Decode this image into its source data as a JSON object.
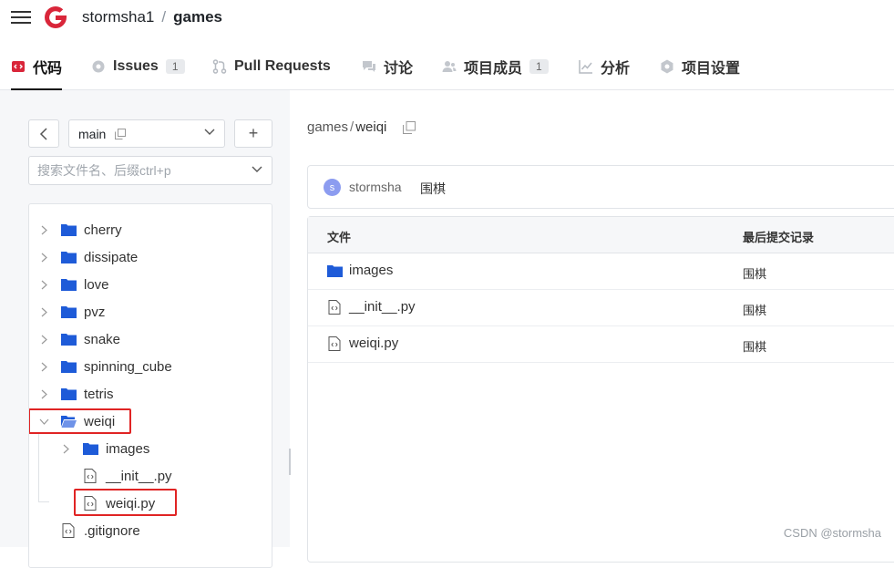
{
  "header": {
    "owner": "stormsha1",
    "separator": "/",
    "repo": "games"
  },
  "tabs": [
    {
      "label": "代码",
      "icon": "code-icon",
      "active": true
    },
    {
      "label": "Issues",
      "icon": "issue-icon",
      "count": "1"
    },
    {
      "label": "Pull Requests",
      "icon": "pull-request-icon"
    },
    {
      "label": "讨论",
      "icon": "discussion-icon"
    },
    {
      "label": "项目成员",
      "icon": "members-icon",
      "count": "1"
    },
    {
      "label": "分析",
      "icon": "analytics-icon"
    },
    {
      "label": "项目设置",
      "icon": "settings-icon"
    }
  ],
  "sidebar": {
    "branch": "main",
    "add_label": "+",
    "search_placeholder": "搜索文件名、后缀ctrl+p",
    "tree": [
      {
        "label": "cherry",
        "type": "folder",
        "expanded": false
      },
      {
        "label": "dissipate",
        "type": "folder",
        "expanded": false
      },
      {
        "label": "love",
        "type": "folder",
        "expanded": false
      },
      {
        "label": "pvz",
        "type": "folder",
        "expanded": false
      },
      {
        "label": "snake",
        "type": "folder",
        "expanded": false
      },
      {
        "label": "spinning_cube",
        "type": "folder",
        "expanded": false
      },
      {
        "label": "tetris",
        "type": "folder",
        "expanded": false
      },
      {
        "label": "weiqi",
        "type": "folder",
        "expanded": true
      },
      {
        "label": "images",
        "type": "folder",
        "expanded": false
      },
      {
        "label": "__init__.py",
        "type": "file"
      },
      {
        "label": "weiqi.py",
        "type": "file"
      },
      {
        "label": ".gitignore",
        "type": "file"
      }
    ]
  },
  "main": {
    "breadcrumb": [
      "games",
      "weiqi"
    ],
    "breadcrumb_sep": "/",
    "commit": {
      "avatar_letter": "s",
      "author": "stormsha",
      "message": "围棋"
    },
    "table": {
      "col_file": "文件",
      "col_commit": "最后提交记录",
      "rows": [
        {
          "name": "images",
          "type": "folder",
          "commit": "围棋"
        },
        {
          "name": "__init__.py",
          "type": "file",
          "commit": "围棋"
        },
        {
          "name": "weiqi.py",
          "type": "file",
          "commit": "围棋"
        }
      ]
    }
  },
  "watermark": "CSDN @stormsha",
  "colors": {
    "brand": "#d9263a",
    "folder": "#1e5bd8",
    "highlight": "#e02424"
  }
}
